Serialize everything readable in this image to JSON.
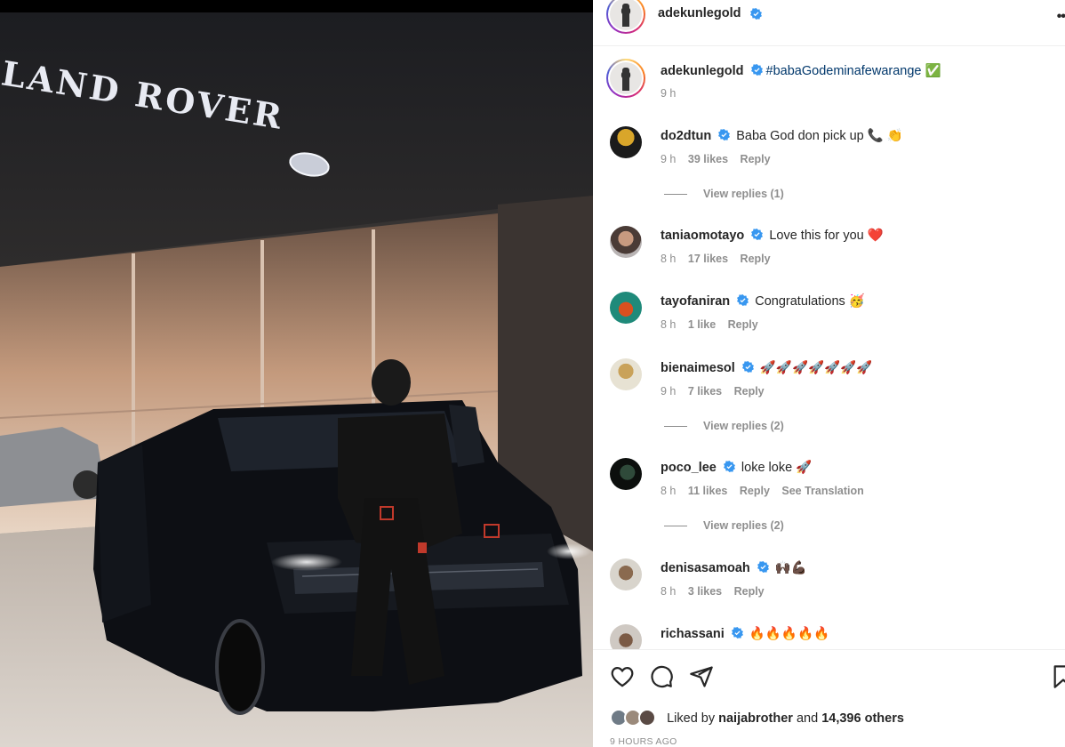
{
  "post": {
    "author": "adekunlegold",
    "caption_hashtag": "#babaGodeminafewarange",
    "caption_emoji": "✅",
    "caption_time": "9 h",
    "photo_sign_text": "LAND ROVER"
  },
  "comments": [
    {
      "user": "do2dtun",
      "text": "Baba God don pick up 📞 👏",
      "time": "9 h",
      "likes": "39 likes",
      "reply": "Reply",
      "view_replies": "View replies (1)"
    },
    {
      "user": "taniaomotayo",
      "text": "Love this for you ❤️",
      "time": "8 h",
      "likes": "17 likes",
      "reply": "Reply"
    },
    {
      "user": "tayofaniran",
      "text": "Congratulations 🥳",
      "time": "8 h",
      "likes": "1 like",
      "reply": "Reply"
    },
    {
      "user": "bienaimesol",
      "text": "🚀🚀🚀🚀🚀🚀🚀",
      "time": "9 h",
      "likes": "7 likes",
      "reply": "Reply",
      "view_replies": "View replies (2)"
    },
    {
      "user": "poco_lee",
      "text": "loke loke 🚀",
      "time": "8 h",
      "likes": "11 likes",
      "reply": "Reply",
      "translate": "See Translation",
      "view_replies": "View replies (2)"
    },
    {
      "user": "denisasamoah",
      "text": "🙌🏿💪🏿",
      "time": "8 h",
      "likes": "3 likes",
      "reply": "Reply"
    },
    {
      "user": "richassani",
      "text": "🔥🔥🔥🔥🔥"
    }
  ],
  "footer": {
    "liked_by_prefix": "Liked by",
    "liked_by_user": "naijabrother",
    "and": "and",
    "others": "14,396 others",
    "posted": "9 HOURS AGO"
  },
  "icons": [
    "heart-icon",
    "comment-icon",
    "share-icon",
    "bookmark-icon",
    "verified-badge-icon",
    "more-options-icon"
  ],
  "colors": {
    "verified": "#3897f0",
    "hashtag": "#00376b",
    "muted": "#8e8e8e",
    "text": "#262626"
  }
}
